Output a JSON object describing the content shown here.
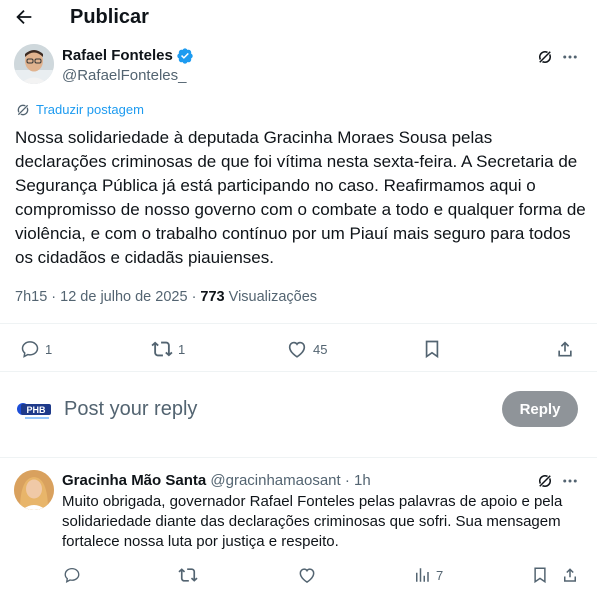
{
  "header": {
    "title": "Publicar"
  },
  "post": {
    "author_name": "Rafael Fonteles",
    "author_handle": "@RafaelFonteles_",
    "translate_label": "Traduzir postagem",
    "text": "Nossa solidariedade à deputada Gracinha Moraes Sousa pelas declarações criminosas de que foi vítima nesta sexta-feira. A Secretaria de Segurança Pública já está participando no caso. Reafirmamos aqui o compromisso de nosso governo com o combate a todo e qualquer forma de violência, e com o trabalho contínuo por um Piauí mais seguro para todos os cidadãos e cidadãs piauienses.",
    "timestamp": "7h15 · 12 de julho de 2025 · ",
    "views_count": "773",
    "views_label": " Visualizações",
    "replies": "1",
    "reposts": "1",
    "likes": "45"
  },
  "compose": {
    "placeholder": "Post your reply",
    "reply_label": "Reply",
    "logo_text": "PHB"
  },
  "reply": {
    "author_name": "Gracinha Mão Santa",
    "author_meta": " @gracinhamaosant · 1h",
    "text": "Muito obrigada, governador Rafael Fonteles pelas palavras de apoio e pela solidariedade diante das declarações criminosas que sofri. Sua mensagem fortalece nossa luta por justiça e respeito.",
    "views": "7"
  },
  "colors": {
    "accent": "#1d9bf0",
    "muted_text": "#536471",
    "reply_button_disabled": "#8f9499"
  }
}
